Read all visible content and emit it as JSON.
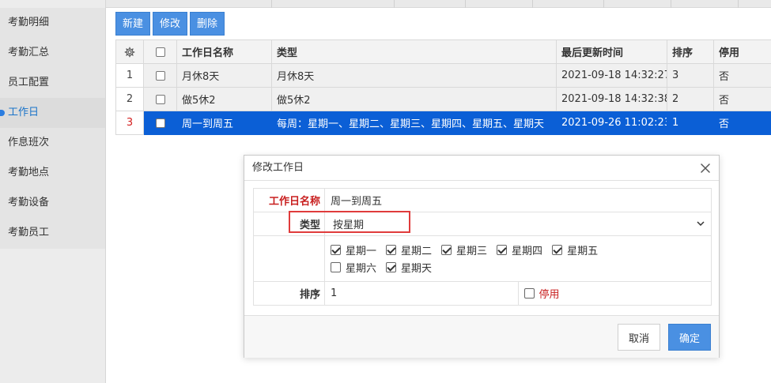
{
  "sidebar": {
    "items": [
      {
        "label": "考勤明细"
      },
      {
        "label": "考勤汇总"
      },
      {
        "label": "员工配置"
      },
      {
        "label": "工作日"
      },
      {
        "label": "作息班次"
      },
      {
        "label": "考勤地点"
      },
      {
        "label": "考勤设备"
      },
      {
        "label": "考勤员工"
      }
    ],
    "active_index": 3
  },
  "toolbar": {
    "new_label": "新建",
    "edit_label": "修改",
    "delete_label": "删除"
  },
  "table": {
    "headers": {
      "name": "工作日名称",
      "type": "类型",
      "updated": "最后更新时间",
      "order": "排序",
      "disabled": "停用"
    },
    "rows": [
      {
        "num": "1",
        "name": "月休8天",
        "type": "月休8天",
        "updated": "2021-09-18 14:32:27",
        "order": "3",
        "disabled": "否"
      },
      {
        "num": "2",
        "name": "做5休2",
        "type": "做5休2",
        "updated": "2021-09-18 14:32:38",
        "order": "2",
        "disabled": "否"
      },
      {
        "num": "3",
        "name": "周一到周五",
        "type": "每周：星期一、星期二、星期三、星期四、星期五、星期天",
        "updated": "2021-09-26 11:02:23",
        "order": "1",
        "disabled": "否"
      }
    ],
    "selected_row": 2
  },
  "dialog": {
    "title": "修改工作日",
    "name_label": "工作日名称",
    "name_value": "周一到周五",
    "type_label": "类型",
    "type_value": "按星期",
    "days": [
      {
        "label": "星期一",
        "checked": true
      },
      {
        "label": "星期二",
        "checked": true
      },
      {
        "label": "星期三",
        "checked": true
      },
      {
        "label": "星期四",
        "checked": true
      },
      {
        "label": "星期五",
        "checked": true
      },
      {
        "label": "星期六",
        "checked": false
      },
      {
        "label": "星期天",
        "checked": true
      }
    ],
    "order_label": "排序",
    "order_value": "1",
    "disable_label": "停用",
    "cancel_label": "取消",
    "ok_label": "确定"
  },
  "colors": {
    "primary": "#4a90e2",
    "selected_row": "#0b5fd6",
    "required_label": "#c81e1e",
    "highlight_box": "#e03b3b"
  }
}
